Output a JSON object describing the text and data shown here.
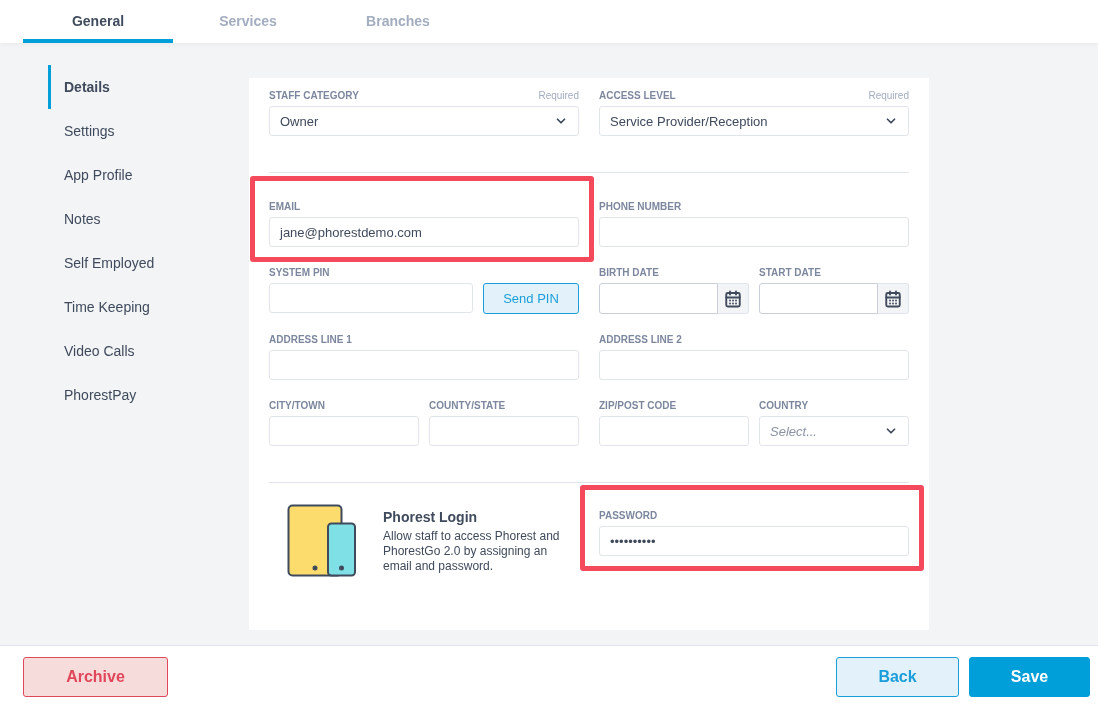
{
  "tabs": [
    {
      "label": "General",
      "selected": true
    },
    {
      "label": "Services",
      "selected": false
    },
    {
      "label": "Branches",
      "selected": false
    }
  ],
  "sidebar": {
    "items": [
      {
        "label": "Details",
        "selected": true
      },
      {
        "label": "Settings",
        "selected": false
      },
      {
        "label": "App Profile",
        "selected": false
      },
      {
        "label": "Notes",
        "selected": false
      },
      {
        "label": "Self Employed",
        "selected": false
      },
      {
        "label": "Time Keeping",
        "selected": false
      },
      {
        "label": "Video Calls",
        "selected": false
      },
      {
        "label": "PhorestPay",
        "selected": false
      }
    ]
  },
  "form": {
    "top": [
      {
        "left": [
          {
            "kind": "select",
            "label": "STAFF CATEGORY",
            "required": "Required",
            "value": "Owner"
          }
        ],
        "right": [
          {
            "kind": "select",
            "label": "ACCESS LEVEL",
            "required": "Required",
            "value": "Service Provider/Reception"
          }
        ]
      }
    ],
    "rows": [
      {
        "left": [
          {
            "kind": "text",
            "label": "EMAIL",
            "value": "jane@phorestdemo.com",
            "highlighted": true
          }
        ],
        "right": [
          {
            "kind": "text",
            "label": "PHONE NUMBER"
          }
        ]
      },
      {
        "left": [
          {
            "kind": "pin",
            "label": "SYSTEM PIN",
            "button": "Send PIN"
          }
        ],
        "right": [
          {
            "kind": "date",
            "label": "BIRTH DATE"
          },
          {
            "kind": "date",
            "label": "START DATE"
          }
        ]
      },
      {
        "left": [
          {
            "kind": "text",
            "label": "ADDRESS LINE 1"
          }
        ],
        "right": [
          {
            "kind": "text",
            "label": "ADDRESS LINE 2"
          }
        ]
      },
      {
        "left": [
          {
            "kind": "text",
            "label": "CITY/TOWN"
          },
          {
            "kind": "text",
            "label": "COUNTY/STATE"
          }
        ],
        "right": [
          {
            "kind": "text",
            "label": "ZIP/POST CODE"
          },
          {
            "kind": "select",
            "label": "COUNTRY",
            "placeholder": "Select..."
          }
        ]
      }
    ],
    "login": {
      "title": "Phorest Login",
      "description": "Allow staff to access Phorest and PhorestGo 2.0 by assigning an email and password.",
      "field": {
        "kind": "text",
        "label": "PASSWORD",
        "value": "••••••••••",
        "highlighted": true
      }
    }
  },
  "footer": {
    "buttons": [
      {
        "label": "Archive",
        "kind": "danger"
      },
      {
        "label": "Back",
        "kind": "secondary"
      },
      {
        "label": "Save",
        "kind": "primary"
      }
    ]
  }
}
